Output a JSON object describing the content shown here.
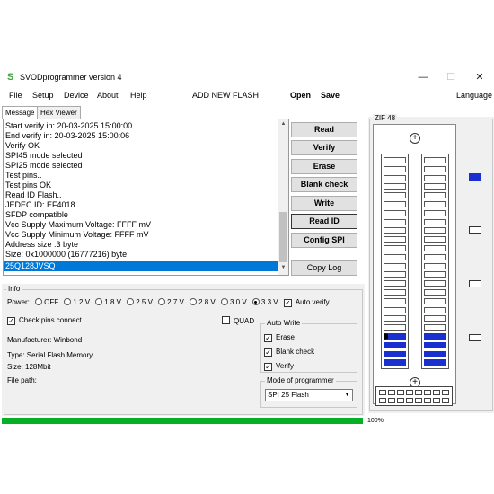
{
  "window": {
    "title": "SVODprogrammer version 4",
    "icon": "S",
    "minimize": "—",
    "maximize": "☐",
    "close": "✕"
  },
  "menu": {
    "file": "File",
    "setup": "Setup",
    "device": "Device",
    "about": "About",
    "help": "Help",
    "add_flash": "ADD NEW FLASH",
    "open": "Open",
    "save": "Save",
    "language": "Language"
  },
  "tabs": {
    "message": "Message",
    "hex_viewer": "Hex Viewer"
  },
  "log": [
    "Start verify in: 20-03-2025 15:00:00",
    "End verify in: 20-03-2025 15:00:06",
    "Verify OK",
    "SPI45 mode selected",
    "SPI25 mode selected",
    "Test pins..",
    "Test pins OK",
    "Read ID Flash..",
    "JEDEC ID: EF4018",
    "SFDP compatible",
    "Vcc Supply Maximum Voltage: FFFF mV",
    "Vcc Supply Minimum Voltage: FFFF mV",
    "Address size :3 byte",
    "Size: 0x1000000 (16777216) byte",
    "25Q128JVSQ"
  ],
  "buttons": {
    "read": "Read",
    "verify": "Verify",
    "erase": "Erase",
    "blank_check": "Blank check",
    "write": "Write",
    "read_id": "Read ID",
    "config_spi": "Config SPI",
    "copy_log": "Copy Log"
  },
  "info": {
    "group_label": "Info",
    "power_label": "Power:",
    "power_options": [
      "OFF",
      "1.2 V",
      "1.8 V",
      "2.5 V",
      "2.7 V",
      "2.8 V",
      "3.0 V",
      "3.3 V"
    ],
    "power_selected": "3.3 V",
    "auto_verify": "Auto verify",
    "check_pins": "Check pins connect",
    "quad": "QUAD",
    "manufacturer": "Manufacturer: Winbond",
    "type": "Type:  Serial Flash Memory",
    "size": "Size: 128Mbit",
    "file_path": "File path:"
  },
  "auto_write": {
    "label": "Auto Write",
    "erase": "Erase",
    "blank_check": "Blank check",
    "verify": "Verify"
  },
  "mode": {
    "label": "Mode of programmer",
    "value": "SPI 25 Flash"
  },
  "zif": {
    "label": "ZIF 48"
  },
  "progress": {
    "value": 1.0,
    "label": "100%"
  },
  "colors": {
    "selection": "#0078d7",
    "progress": "#06b025",
    "pin_active": "#1a2fd0"
  }
}
